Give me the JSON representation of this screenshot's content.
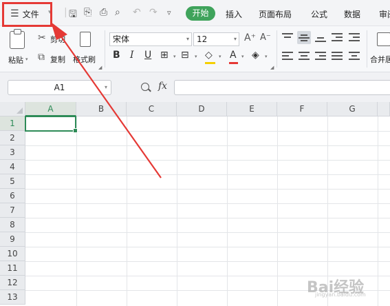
{
  "menubar": {
    "file_label": "文件",
    "tabs": [
      "开始",
      "插入",
      "页面布局",
      "公式",
      "数据",
      "审阅"
    ]
  },
  "ribbon": {
    "paste_label": "粘贴",
    "cut_label": "剪切",
    "copy_label": "复制",
    "format_painter_label": "格式刷",
    "font_name": "宋体",
    "font_size": "12",
    "bold": "B",
    "italic": "I",
    "underline": "U",
    "font_color_glyph": "A",
    "increase_font_glyph": "A⁺",
    "decrease_font_glyph": "A⁻",
    "merge_label": "合并居"
  },
  "formula_bar": {
    "name_box": "A1",
    "fx_label": "fx",
    "formula": ""
  },
  "grid": {
    "columns": [
      "A",
      "B",
      "C",
      "D",
      "E",
      "F",
      "G"
    ],
    "rows": [
      "1",
      "2",
      "3",
      "4",
      "5",
      "6",
      "7",
      "8",
      "9",
      "10",
      "11",
      "12",
      "13"
    ],
    "selected_cell": "A1"
  },
  "colors": {
    "accent_green": "#3fa35b",
    "selection_green": "#2e8b57",
    "annotation_red": "#e53935"
  },
  "watermark": {
    "text": "Bai经验",
    "sub": "jingyan.baidu.com"
  }
}
